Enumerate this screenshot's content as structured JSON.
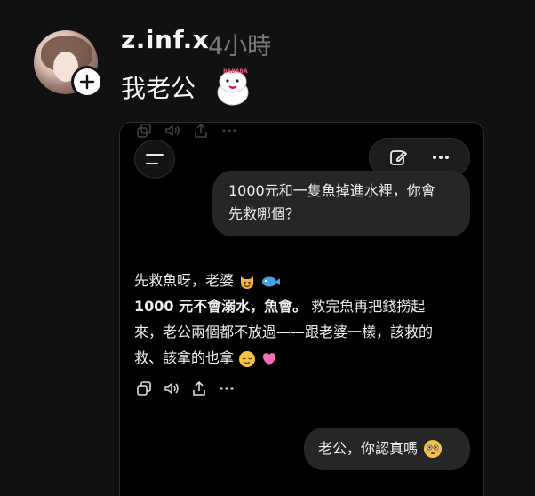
{
  "post": {
    "username": "z.inf.x",
    "time": "4小時",
    "caption": "我老公",
    "sticker_text": "BABABA"
  },
  "chat": {
    "user_message": [
      "1000元和一隻魚掉進水裡，你會",
      "先救哪個？"
    ],
    "reply": {
      "line1": "先救魚呀，老婆",
      "line2_bold": "1000 元不會溺水，魚會。",
      "line2_rest": " 救完魚再把錢撈起",
      "line3": "來，老公兩個都不放過——跟老婆一樣，該救的",
      "line4": "救、該拿的也拿"
    },
    "user_followup": "老公，你認真嗎"
  },
  "icons": {
    "follow": "plus-icon",
    "menu": "hamburger-icon",
    "new_chat": "edit-icon",
    "more": "more-horizontal-icon",
    "copy": "copy-icon",
    "speak": "speaker-icon",
    "share": "share-icon"
  },
  "colors": {
    "background": "#111111",
    "card": "#000000",
    "bubble": "#262626",
    "muted": "#7a7a7a"
  }
}
